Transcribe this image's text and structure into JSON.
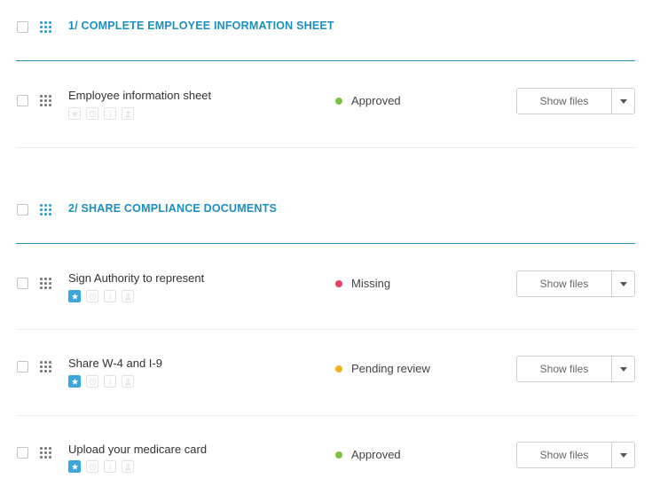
{
  "sections": [
    {
      "title": "1/ COMPLETE EMPLOYEE INFORMATION SHEET",
      "tasks": [
        {
          "title": "Employee information sheet",
          "starred": false,
          "status": "Approved",
          "status_color": "#7cc242",
          "button": "Show files"
        }
      ]
    },
    {
      "title": "2/ SHARE COMPLIANCE DOCUMENTS",
      "tasks": [
        {
          "title": "Sign Authority to represent",
          "starred": true,
          "status": "Missing",
          "status_color": "#ec3b66",
          "button": "Show files"
        },
        {
          "title": "Share W-4 and I-9",
          "starred": true,
          "status": "Pending review",
          "status_color": "#f6b123",
          "button": "Show files"
        },
        {
          "title": "Upload your medicare card",
          "starred": true,
          "status": "Approved",
          "status_color": "#7cc242",
          "button": "Show files"
        }
      ]
    }
  ],
  "colors": {
    "accent": "#1b8fc0",
    "section_rule": "#2a8fb5",
    "star_active": "#3aa6dc"
  },
  "task_icons": [
    "star-icon",
    "clock-icon",
    "info-icon",
    "person-icon"
  ]
}
